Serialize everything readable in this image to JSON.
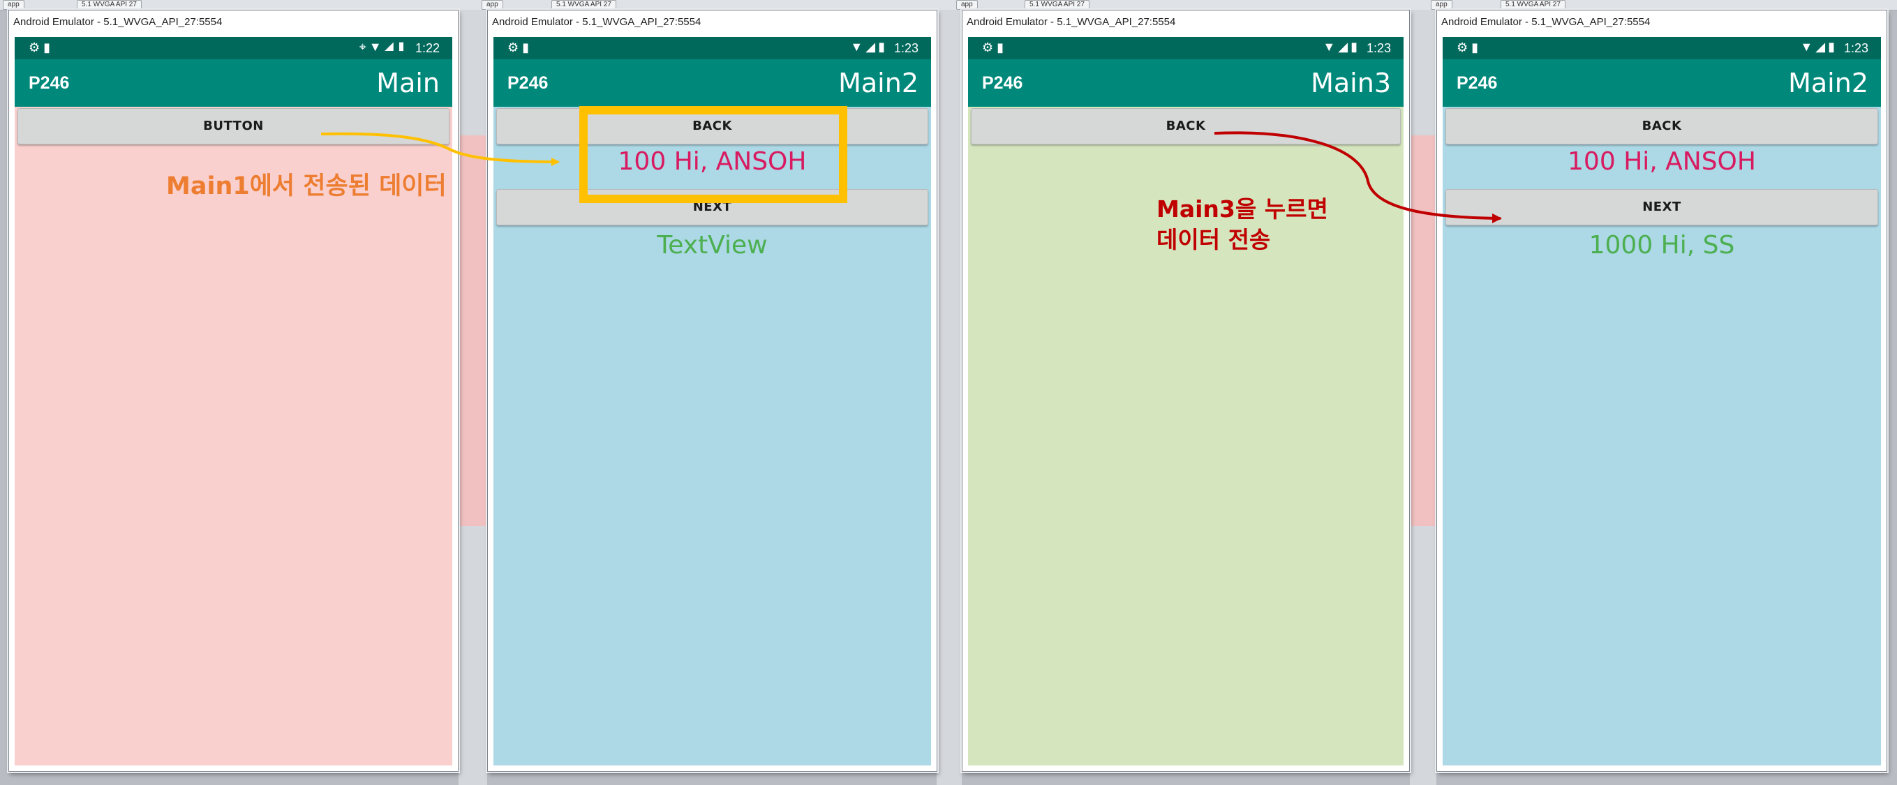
{
  "ide_bar": {
    "chips": [
      "app",
      "5.1 WVGA API 27",
      "app",
      "5.1 WVGA API 27",
      "app",
      "5.1 WVGA API 27",
      "app",
      "5.1 WVGA API 27"
    ]
  },
  "emulators": [
    {
      "window_title": "Android Emulator - 5.1_WVGA_API_27:5554",
      "clock": "1:22",
      "app_name": "P246",
      "activity_title": "Main",
      "background": "#f9d0ce",
      "button1": "BUTTON"
    },
    {
      "window_title": "Android Emulator - 5.1_WVGA_API_27:5554",
      "clock": "1:23",
      "app_name": "P246",
      "activity_title": "Main2",
      "background": "#add8e6",
      "button_back": "BACK",
      "received_text": "100 Hi, ANSOH",
      "button_next": "NEXT",
      "result_text": "TextView"
    },
    {
      "window_title": "Android Emulator - 5.1_WVGA_API_27:5554",
      "clock": "1:23",
      "app_name": "P246",
      "activity_title": "Main3",
      "background": "#d5e6bf",
      "button_back": "BACK"
    },
    {
      "window_title": "Android Emulator - 5.1_WVGA_API_27:5554",
      "clock": "1:23",
      "app_name": "P246",
      "activity_title": "Main2",
      "background": "#add8e6",
      "button_back": "BACK",
      "received_text": "100 Hi, ANSOH",
      "button_next": "NEXT",
      "result_text": "1000 Hi, SS"
    }
  ],
  "annotations": {
    "note1": "Main1에서 전송된 데이터",
    "note2_line1": "Main3을 누르면",
    "note2_line2": "데이터 전송"
  },
  "colors": {
    "status_bar": "#00695c",
    "action_bar": "#00897b",
    "received_text": "#d81b60",
    "result_text": "#4caf50",
    "annotation_orange": "#ed7d31",
    "annotation_red": "#c00000",
    "highlight_box": "#ffc000"
  }
}
